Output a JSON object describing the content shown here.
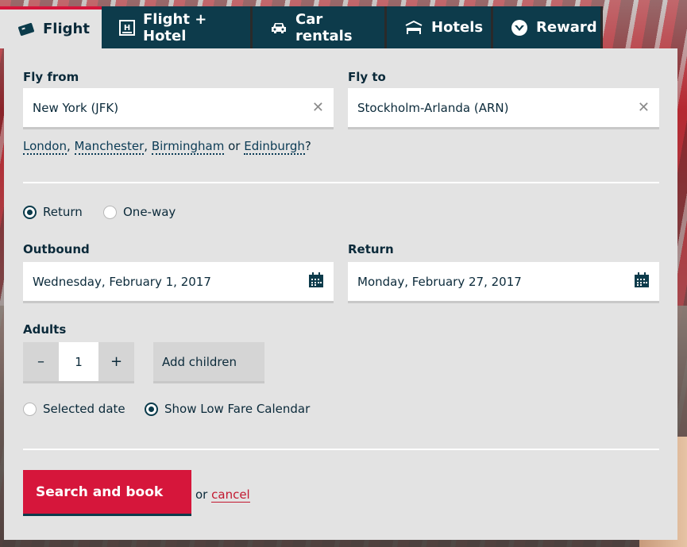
{
  "tabs": [
    {
      "label": "Flight",
      "icon": "ticket-icon",
      "active": true
    },
    {
      "label": "Flight + Hotel",
      "icon": "hotel-h-icon",
      "active": false
    },
    {
      "label": "Car rentals",
      "icon": "car-icon",
      "active": false
    },
    {
      "label": "Hotels",
      "icon": "bed-icon",
      "active": false
    },
    {
      "label": "Reward",
      "icon": "reward-badge-icon",
      "active": false
    }
  ],
  "fly_from": {
    "label": "Fly from",
    "value": "New York (JFK)"
  },
  "fly_to": {
    "label": "Fly to",
    "value": "Stockholm-Arlanda (ARN)"
  },
  "suggestions": {
    "items": [
      "London",
      "Manchester",
      "Birmingham",
      "Edinburgh"
    ],
    "separator1": ",",
    "separator2": ",",
    "separator3": "or",
    "suffix": "?"
  },
  "trip_type": {
    "return_label": "Return",
    "oneway_label": "One-way",
    "selected": "Return"
  },
  "outbound": {
    "label": "Outbound",
    "value": "Wednesday, February 1, 2017"
  },
  "return": {
    "label": "Return",
    "value": "Monday, February 27, 2017"
  },
  "adults": {
    "label": "Adults",
    "value": "1",
    "minus": "–",
    "plus": "+"
  },
  "add_children": "Add children",
  "date_mode": {
    "selected_date_label": "Selected date",
    "low_fare_label": "Show Low Fare Calendar",
    "selected": "Show Low Fare Calendar"
  },
  "actions": {
    "search_label": "Search and book",
    "or_text": "or",
    "cancel_label": "cancel"
  },
  "colors": {
    "navy": "#0d3b4b",
    "accent_red": "#d6163b",
    "panel": "#e3e3e3"
  }
}
